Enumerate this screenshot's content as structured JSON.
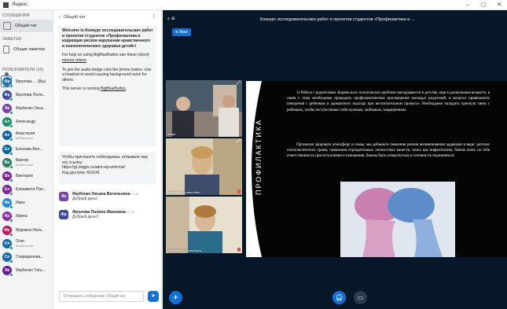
{
  "browser": {
    "title": "Яндекс"
  },
  "sidebar": {
    "messages_header": "СООБЩЕНИЯ",
    "public_chat": "Общий чат",
    "notes_header": "ЗАМЕТКИ",
    "shared_notes": "Общие заметки",
    "users_header": "ПОЛЬЗОВАТЕЛИ (15)",
    "users": [
      {
        "initials": "Фр",
        "name": "Фролова ...",
        "suffix": "(Вы)",
        "color": "#1f6fb5",
        "sub": ""
      },
      {
        "initials": "Фр",
        "name": "Фролова Поли...",
        "color": "#3949ab",
        "sub": ""
      },
      {
        "initials": "Як",
        "name": "Якубенко Окса...",
        "color": "#7a3fb0",
        "sub": ""
      },
      {
        "initials": "Ал",
        "name": "Александр",
        "color": "#1b8a6b",
        "sub": ""
      },
      {
        "initials": "Ан",
        "name": "Анастасия",
        "color": "#0b61a4",
        "sub": "Мобильный"
      },
      {
        "initials": "Ел",
        "name": "Еленова Вал...",
        "color": "#0b61a4",
        "sub": ""
      },
      {
        "initials": "Ви",
        "name": "Виктор",
        "color": "#2d7f5e",
        "sub": "Мобильный"
      },
      {
        "initials": "Ви",
        "name": "Виктория",
        "color": "#7b1fa2",
        "sub": ""
      },
      {
        "initials": "Ел",
        "name": "Елизавета Пан...",
        "color": "#7b1fa2",
        "sub": ""
      },
      {
        "initials": "Ив",
        "name": "Иван",
        "color": "#1e88e5",
        "sub": ""
      },
      {
        "initials": "Ир",
        "name": "Ирина",
        "color": "#8e24aa",
        "sub": ""
      },
      {
        "initials": "Му",
        "name": "Мурзина Ната...",
        "color": "#c2185b",
        "sub": ""
      },
      {
        "initials": "Ол",
        "name": "Олег",
        "color": "#0d6aa6",
        "sub": "Мобильный"
      },
      {
        "initials": "Сп",
        "name": "Спиридонова...",
        "color": "#1565c0",
        "sub": ""
      },
      {
        "initials": "Як",
        "name": "Якубенко Тать...",
        "color": "#6a1b9a",
        "sub": ""
      }
    ]
  },
  "chat": {
    "header": "Общий чат",
    "welcome_title": "Welcome to Конкурс исследовательских работ и проектов студентов «Профилактика и коррекция рисков нарушения нравственного и психологического здоровья детей»!",
    "welcome_help_pre": "For help on using BigBlueButton see these (short)",
    "welcome_help_link": "tutorial videos",
    "welcome_audio": "To join the audio bridge click the phone button. Use a headset to avoid causing background noise for others.",
    "welcome_running_pre": "This server is running",
    "welcome_running_link": "BigBlueButton",
    "invite_text": "Чтобы пригласить собеседника, отправьте ему эту ссылку:",
    "invite_link": "https://gt.oegpu.ru/adm-elp-wmt-kwf",
    "invite_code": "Код доступа: 651041",
    "messages": [
      {
        "initials": "Як",
        "color": "#7a3fb0",
        "author": "Якубенко Оксана Витальевна",
        "time": "17:44",
        "text": "Добрый день!"
      },
      {
        "initials": "Фр",
        "color": "#3949ab",
        "author": "Фролова Полина Ивановна",
        "time": "17:44",
        "text": "Добрый день!!"
      }
    ],
    "composer_placeholder": "Отправить сообщение Общий чат"
  },
  "meeting": {
    "title": "Конкурс исследовательских работ и проектов студентов «Профилактика и ...",
    "talking": "Иван",
    "videos": [
      {
        "name": "Иван"
      },
      {
        "name": "Фролова Полина Ива..."
      },
      {
        "name": "Якубенко Оксана Вита..."
      }
    ]
  },
  "slide": {
    "vertical_title": "ПРОФИЛАКТИКА",
    "paragraph1": "1) Работа с родителями. Корень всех психических проблем закладывается в детстве, еще в дошкольном возрасте, в связи с этим необходимо проводить профилактическое просвещение молодых родителей, в вопросе правильного поведения с ребенком и адекватного подхода при воспитательном процессе. Необходимо наладить крепкую связь с ребенком, чтобы он чувствовал себя нужным, любимым, защищенным.",
    "paragraph2": "Организуя здоровую атмосферу в семье, мы добьемся снижения рисков возникновения аддикции в виде: детских психологических травм; появления отрицательных личностных качеств, таких как инфантилизм, боязнь взять на себя ответственность при вступлении в отношения, боязнь быть отвергнутым и готовность подчиняться."
  }
}
